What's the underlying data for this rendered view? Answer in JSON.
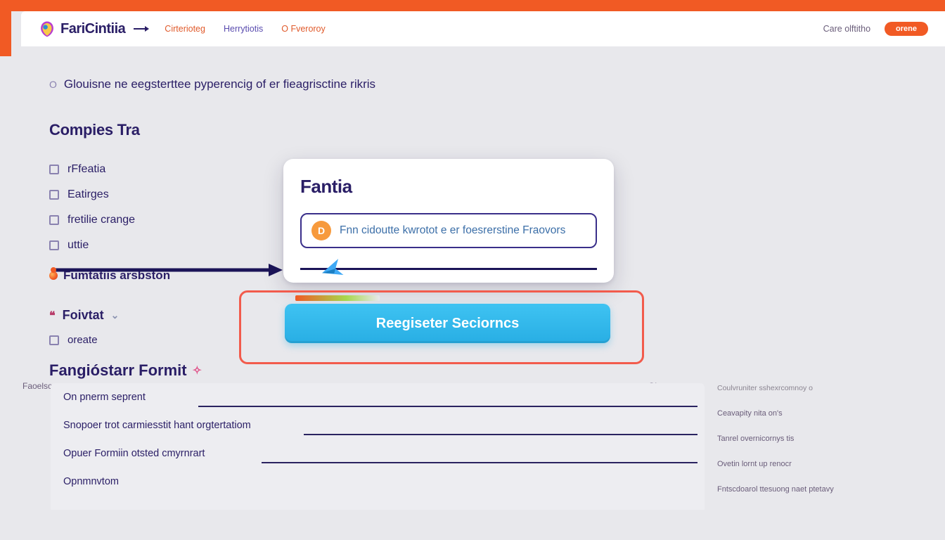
{
  "brand": {
    "name": "FariCintiia"
  },
  "nav": {
    "items": [
      "Cirterioteg",
      "Herrytiotis",
      "Fveroroy"
    ],
    "right_link": "Care olftitho",
    "cta": "orene"
  },
  "breadcrumb": "Glouisne ne eegsterttee pyperencig of er fieagrisctine rikris",
  "section1_title": "Compies Tra",
  "checklist": [
    "rFfeatia",
    "Eatirges",
    "fretilie crange",
    "uttie"
  ],
  "stage_label": "Fumtatiis arsbston",
  "sub_nav": {
    "label": "Foivtat",
    "create": "oreate"
  },
  "section2_title": "Fangióstarr Formit",
  "modal": {
    "title": "Fantia",
    "badge": "D",
    "field_text": "Fnn cidoutte kwrotot e er foesrerstine Fraovors"
  },
  "cta_button": "Reegiseter Seciorncs",
  "form": {
    "header_left": "Faoelsoportorets",
    "header_right": "Olorster",
    "rows": [
      "On pnerm seprent",
      "Snopoer trot carmiesstit hant orgtertatiom",
      "Opuer Formiin otsted cmyrnrart",
      "Opnmnvtom"
    ]
  },
  "side_notes": {
    "header": "Coulvruniter sshexrcomnoy o",
    "items": [
      "Ceavapity nita on's",
      "Tanrel overnicornys tis",
      "Ovetin lornt up renocr",
      "Fntscdoarol ttesuong naet ptetavy"
    ]
  }
}
